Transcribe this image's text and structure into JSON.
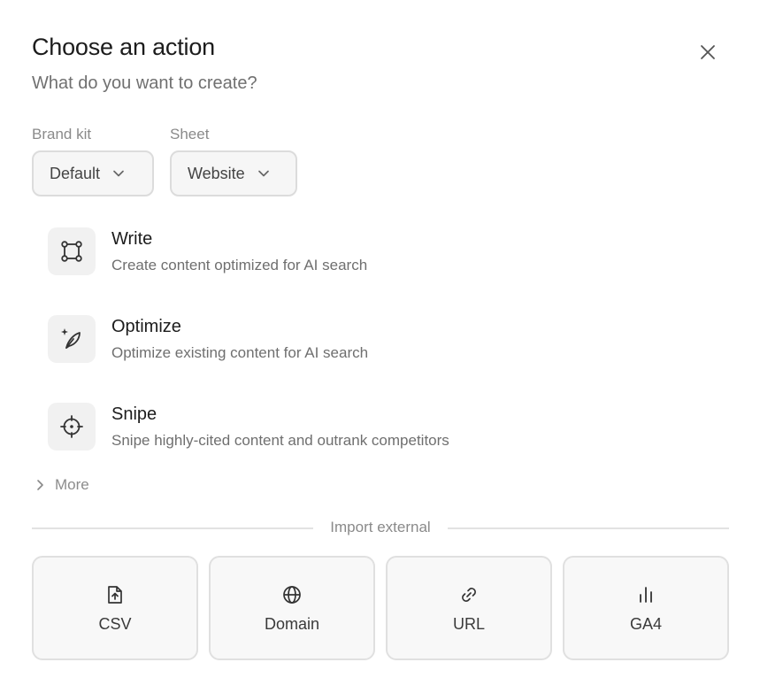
{
  "dialog": {
    "title": "Choose an action",
    "subtitle": "What do you want to create?",
    "close_icon": "close-icon"
  },
  "filters": {
    "brand_kit": {
      "label": "Brand kit",
      "value": "Default"
    },
    "sheet": {
      "label": "Sheet",
      "value": "Website"
    }
  },
  "actions": [
    {
      "title": "Write",
      "description": "Create content optimized for AI search",
      "icon": "frame-icon"
    },
    {
      "title": "Optimize",
      "description": "Optimize existing content for AI search",
      "icon": "sparkle-feather-icon"
    },
    {
      "title": "Snipe",
      "description": "Snipe highly-cited content and outrank competitors",
      "icon": "crosshair-icon"
    }
  ],
  "more_label": "More",
  "import": {
    "heading": "Import external",
    "items": [
      {
        "label": "CSV",
        "icon": "file-upload-icon"
      },
      {
        "label": "Domain",
        "icon": "globe-icon"
      },
      {
        "label": "URL",
        "icon": "link-icon"
      },
      {
        "label": "GA4",
        "icon": "bar-chart-icon"
      }
    ]
  }
}
